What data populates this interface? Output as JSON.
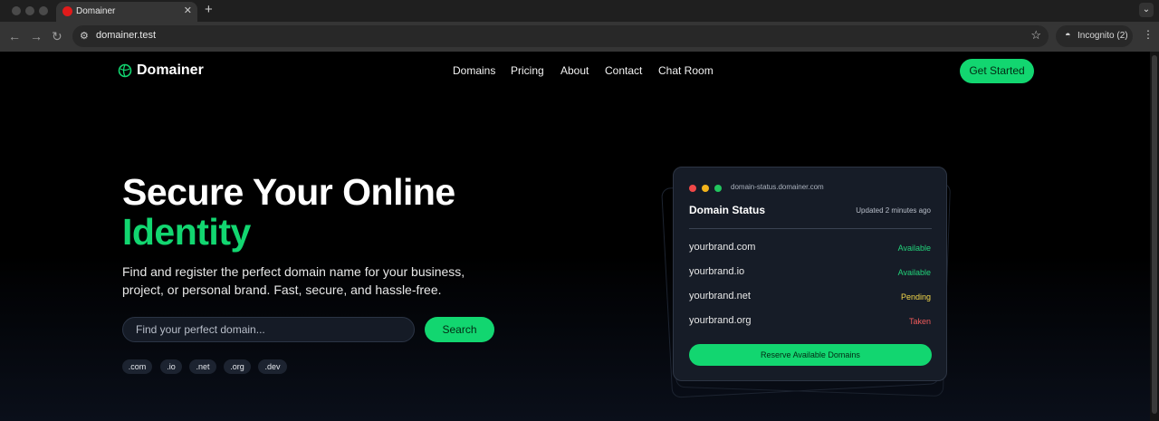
{
  "browser": {
    "tab_title": "Domainer",
    "new_tab": "+",
    "url": "domainer.test",
    "incognito_label": "Incognito (2)"
  },
  "header": {
    "logo_text": "Domainer",
    "nav": [
      "Domains",
      "Pricing",
      "About",
      "Contact",
      "Chat Room"
    ],
    "cta": "Get Started"
  },
  "hero": {
    "title_line1": "Secure Your Online",
    "title_line2": "Identity",
    "subtitle": "Find and register the perfect domain name for your business, project, or personal brand. Fast, secure, and hassle-free.",
    "search_placeholder": "Find your perfect domain...",
    "search_button": "Search",
    "tlds": [
      ".com",
      ".io",
      ".net",
      ".org",
      ".dev"
    ]
  },
  "status_card": {
    "host": "domain-status.domainer.com",
    "title": "Domain Status",
    "updated": "Updated 2 minutes ago",
    "rows": [
      {
        "domain": "yourbrand.com",
        "status": "Available"
      },
      {
        "domain": "yourbrand.io",
        "status": "Available"
      },
      {
        "domain": "yourbrand.net",
        "status": "Pending"
      },
      {
        "domain": "yourbrand.org",
        "status": "Taken"
      }
    ],
    "button": "Reserve Available Domains"
  },
  "colors": {
    "accent": "#12d670",
    "available": "#22d37a",
    "pending": "#f5d84a",
    "taken": "#f05b5b",
    "background": "#000000"
  }
}
